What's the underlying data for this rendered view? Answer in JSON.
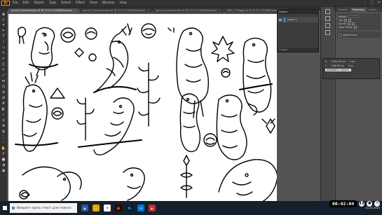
{
  "app": {
    "logo": "Ai",
    "menu": [
      "File",
      "Edit",
      "Object",
      "Type",
      "Select",
      "Effect",
      "View",
      "Window",
      "Help"
    ]
  },
  "tabs": [
    {
      "label": "parrot-1(converted).ai* @ 37.8 % (RGB/Preview)",
      "active": true
    },
    {
      "label": "parrot2-1(converted).ai* @ 37.8 % (RGB/Preview)",
      "active": false
    },
    {
      "label": "parrot-1(converted).ai* @ 37.8 % (RGB/Preview)",
      "active": false
    },
    {
      "label": "PAR_17 Bugg1.ai @ 37.8 % (RGB/Preview)",
      "active": false
    }
  ],
  "layers_panel": {
    "title": "Layers",
    "layer_name": "Layer 1",
    "footer": "1 Layer"
  },
  "right_panel": {
    "tabs": [
      "Libraries",
      "Properties",
      "Layers"
    ],
    "labels": [
      "Weight",
      "Cap",
      "Corner",
      "Align Stroke",
      "Dashed Line"
    ],
    "weight_value": "1 pt"
  },
  "transform_panel": {
    "x_label": "X",
    "x_value": "1246,754 px",
    "y_label": "Y",
    "y_value": "1106,99 px",
    "w_value": "0 px",
    "h_value": "0 px",
    "badge": "ДОБАВИТЬ ОБЪЕКТ"
  },
  "taskbar": {
    "search_placeholder": "Введите здесь текст для поиска",
    "time": "8:27",
    "date": "21.03.2024",
    "lang": "RUS"
  },
  "player": {
    "timer": "00:02:04"
  },
  "colors": {
    "canvas_bg": "#ffffff",
    "ui_bg": "#535353",
    "taskbar": "#14202b",
    "accent": "#1ea3ff"
  }
}
